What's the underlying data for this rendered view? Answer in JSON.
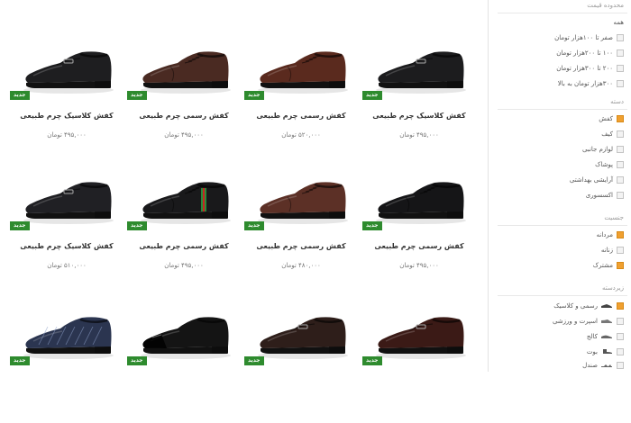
{
  "sidebar": {
    "price": {
      "title": "محدوده قیمت",
      "options": [
        {
          "label": "همه",
          "checked": false,
          "has_box": false
        },
        {
          "label": "صفر تا ۱۰۰هزار تومان",
          "checked": false,
          "has_box": true
        },
        {
          "label": "۱۰۰ تا ۲۰۰هزار تومان",
          "checked": false,
          "has_box": true
        },
        {
          "label": "۲۰۰ تا ۳۰۰هزار تومان",
          "checked": false,
          "has_box": true
        },
        {
          "label": "۳۰۰هزار تومان به بالا",
          "checked": false,
          "has_box": true
        }
      ]
    },
    "category": {
      "title": "دسته",
      "options": [
        {
          "label": "کفش",
          "checked": true
        },
        {
          "label": "کیف",
          "checked": false
        },
        {
          "label": "لوازم جانبی",
          "checked": false
        },
        {
          "label": "پوشاک",
          "checked": false
        },
        {
          "label": "آرایشی بهداشتی",
          "checked": false
        },
        {
          "label": "اکسسوری",
          "checked": false
        }
      ]
    },
    "gender": {
      "title": "جنسیت",
      "options": [
        {
          "label": "مردانه",
          "checked": true
        },
        {
          "label": "زنانه",
          "checked": false
        },
        {
          "label": "مشترک",
          "checked": true
        }
      ]
    },
    "subcategory": {
      "title": "زیردسته",
      "options": [
        {
          "label": "رسمی و کلاسیک",
          "checked": true,
          "icon": "formal-shoe-icon"
        },
        {
          "label": "اسپرت و ورزشی",
          "checked": false,
          "icon": "sneaker-icon"
        },
        {
          "label": "کالج",
          "checked": false,
          "icon": "college-shoe-icon"
        },
        {
          "label": "بوت",
          "checked": false,
          "icon": "boot-icon"
        },
        {
          "label": "صندل",
          "checked": false,
          "icon": "sandal-icon"
        }
      ]
    }
  },
  "products": [
    {
      "name": "کفش کلاسیک چرم طبیعی",
      "price": "۴۹۵,۰۰۰ تومان",
      "badge": "جدید",
      "icon": "loafer-shoe-icon",
      "color": "#1c1c1e"
    },
    {
      "name": "کفش رسمی چرم طبیعی",
      "price": "۵۲۰,۰۰۰ تومان",
      "badge": "جدید",
      "icon": "oxford-shoe-icon",
      "color": "#5a2a1e"
    },
    {
      "name": "کفش رسمی چرم طبیعی",
      "price": "۴۹۵,۰۰۰ تومان",
      "badge": "جدید",
      "icon": "brogue-shoe-icon",
      "color": "#4a2a22"
    },
    {
      "name": "کفش کلاسیک چرم طبیعی",
      "price": "۴۹۵,۰۰۰ تومان",
      "badge": "جدید",
      "icon": "loafer-shoe-icon",
      "color": "#1e1e20"
    },
    {
      "name": "کفش رسمی چرم طبیعی",
      "price": "۴۹۵,۰۰۰ تومان",
      "badge": "جدید",
      "icon": "derby-shoe-icon",
      "color": "#151517"
    },
    {
      "name": "کفش رسمی چرم طبیعی",
      "price": "۴۸۰,۰۰۰ تومان",
      "badge": "جدید",
      "icon": "derby-shoe-icon",
      "color": "#5c3026"
    },
    {
      "name": "کفش رسمی چرم طبیعی",
      "price": "۴۹۵,۰۰۰ تومان",
      "badge": "جدید",
      "icon": "striped-brogue-shoe-icon",
      "color": "#19191b"
    },
    {
      "name": "کفش کلاسیک چرم طبیعی",
      "price": "۵۱۰,۰۰۰ تومان",
      "badge": "جدید",
      "icon": "loafer-shoe-icon",
      "color": "#202024"
    },
    {
      "name": "",
      "price": "",
      "badge": "جدید",
      "icon": "loafer-shoe-icon",
      "color": "#3b1a16"
    },
    {
      "name": "",
      "price": "",
      "badge": "جدید",
      "icon": "loafer-shoe-icon",
      "color": "#2e1e1a"
    },
    {
      "name": "",
      "price": "",
      "badge": "جدید",
      "icon": "suede-shoe-icon",
      "color": "#141414"
    },
    {
      "name": "",
      "price": "",
      "badge": "جدید",
      "icon": "woven-shoe-icon",
      "color": "#2b3550"
    }
  ],
  "colors": {
    "accent": "#f0a030",
    "badge": "#2e8b2e"
  }
}
